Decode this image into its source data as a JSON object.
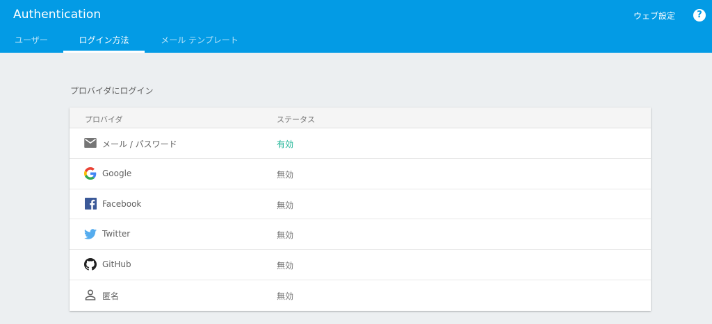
{
  "app": {
    "title": "Authentication",
    "web_settings_label": "ウェブ設定",
    "help_label": "?"
  },
  "tabs": [
    {
      "label": "ユーザー",
      "active": false
    },
    {
      "label": "ログイン方法",
      "active": true
    },
    {
      "label": "メール テンプレート",
      "active": false
    }
  ],
  "section": {
    "title": "プロバイダにログイン"
  },
  "table": {
    "headers": [
      "プロバイダ",
      "ステータス"
    ],
    "rows": [
      {
        "icon": "email-icon",
        "name": "メール / パスワード",
        "status": "有効"
      },
      {
        "icon": "google-icon",
        "name": "Google",
        "status": "無効"
      },
      {
        "icon": "facebook-icon",
        "name": "Facebook",
        "status": "無効"
      },
      {
        "icon": "twitter-icon",
        "name": "Twitter",
        "status": "無効"
      },
      {
        "icon": "github-icon",
        "name": "GitHub",
        "status": "無効"
      },
      {
        "icon": "person-icon",
        "name": "匿名",
        "status": "無効"
      }
    ]
  },
  "colors": {
    "appbar": "#039be5",
    "background": "#eceff1",
    "enabled_status": "#1ab394"
  }
}
